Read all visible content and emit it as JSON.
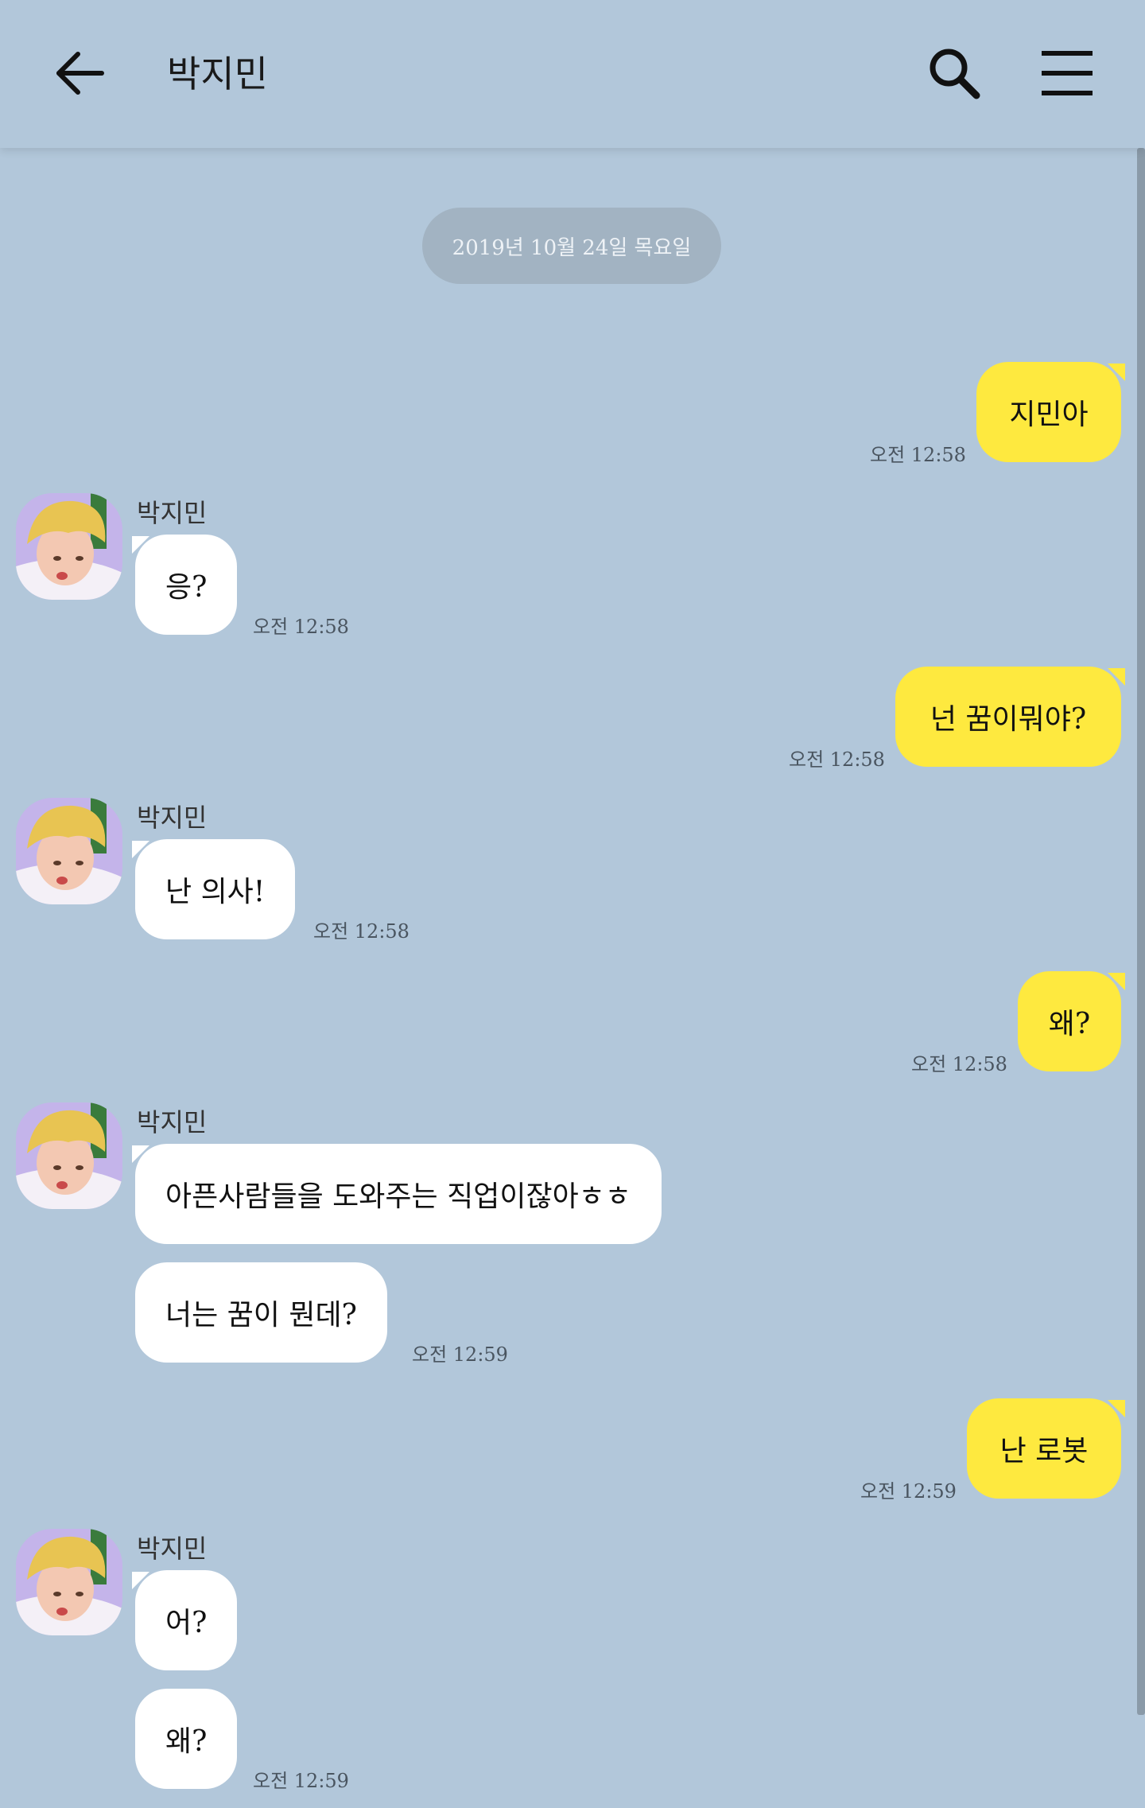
{
  "header": {
    "title": "박지민",
    "back_icon": "arrow-left-icon",
    "search_icon": "search-icon",
    "menu_icon": "hamburger-menu-icon"
  },
  "date_divider": "2019년 10월 24일 목요일",
  "colors": {
    "background": "#b2c7da",
    "my_bubble": "#fee93f",
    "other_bubble": "#ffffff"
  },
  "messages": [
    {
      "from": "me",
      "text": "지민아",
      "time": "오전 12:58"
    },
    {
      "from": "박지민",
      "sender": "박지민",
      "text": "응?",
      "time": "오전 12:58"
    },
    {
      "from": "me",
      "text": "넌 꿈이뭐야?",
      "time": "오전 12:58"
    },
    {
      "from": "박지민",
      "sender": "박지민",
      "text": "난 의사!",
      "time": "오전 12:58"
    },
    {
      "from": "me",
      "text": "왜?",
      "time": "오전 12:58"
    },
    {
      "from": "박지민",
      "sender": "박지민",
      "text": "아픈사람들을 도와주는 직업이잖아ㅎㅎ",
      "time": ""
    },
    {
      "from": "박지민",
      "text": "너는 꿈이 뭔데?",
      "time": "오전 12:59"
    },
    {
      "from": "me",
      "text": "난 로봇",
      "time": "오전 12:59"
    },
    {
      "from": "박지민",
      "sender": "박지민",
      "text": "어?",
      "time": ""
    },
    {
      "from": "박지민",
      "text": "왜?",
      "time": "오전 12:59"
    }
  ]
}
